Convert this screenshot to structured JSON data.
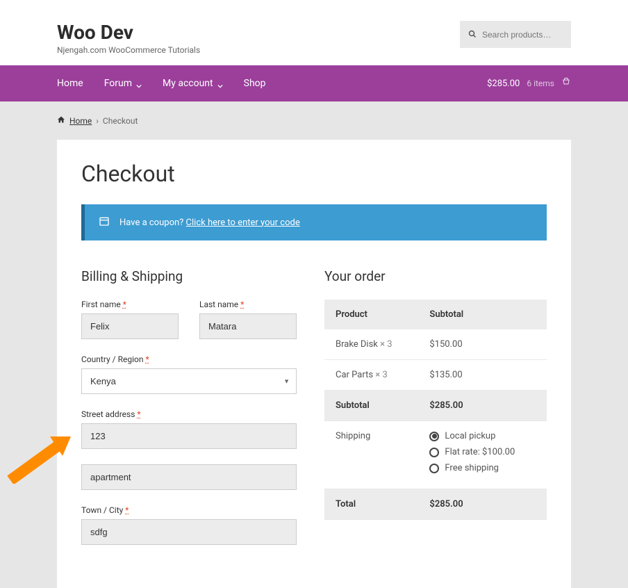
{
  "header": {
    "site_title": "Woo Dev",
    "tagline": "Njengah.com WooCommerce Tutorials",
    "search_placeholder": "Search products…"
  },
  "nav": {
    "items": [
      "Home",
      "Forum",
      "My account",
      "Shop"
    ],
    "cart_total": "$285.00",
    "cart_items": "6 items"
  },
  "breadcrumb": {
    "home": "Home",
    "current": "Checkout"
  },
  "page_title": "Checkout",
  "coupon": {
    "text": "Have a coupon?",
    "link": "Click here to enter your code"
  },
  "billing": {
    "title": "Billing & Shipping",
    "first_name_label": "First name",
    "first_name_value": "Felix",
    "last_name_label": "Last name",
    "last_name_value": "Matara",
    "country_label": "Country / Region",
    "country_value": "Kenya",
    "street_label": "Street address",
    "street_value": "123",
    "apartment_value": "apartment",
    "city_label": "Town / City",
    "city_value": "sdfg"
  },
  "order": {
    "title": "Your order",
    "product_header": "Product",
    "subtotal_header": "Subtotal",
    "items": [
      {
        "name": "Brake Disk",
        "qty": "× 3",
        "price": "$150.00"
      },
      {
        "name": "Car Parts",
        "qty": "× 3",
        "price": "$135.00"
      }
    ],
    "subtotal_label": "Subtotal",
    "subtotal_value": "$285.00",
    "shipping_label": "Shipping",
    "shipping_options": [
      {
        "label": "Local pickup",
        "checked": true
      },
      {
        "label": "Flat rate: $100.00",
        "checked": false
      },
      {
        "label": "Free shipping",
        "checked": false
      }
    ],
    "total_label": "Total",
    "total_value": "$285.00"
  }
}
